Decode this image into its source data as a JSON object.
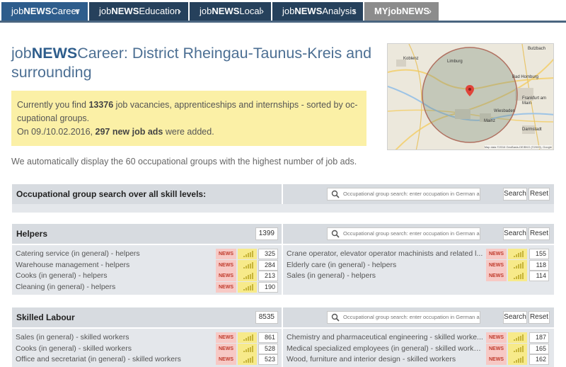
{
  "tabs": [
    {
      "pre": "job",
      "bold": "NEWS",
      "post": "Career",
      "active": true
    },
    {
      "pre": "job",
      "bold": "NEWS",
      "post": "Education",
      "active": false
    },
    {
      "pre": "job",
      "bold": "NEWS",
      "post": "Local",
      "active": false
    },
    {
      "pre": "job",
      "bold": "NEWS",
      "post": "Analysis",
      "active": false
    },
    {
      "pre": "MY",
      "bold": "jobNEWS",
      "post": "",
      "active": false
    }
  ],
  "tab_chevrons": {
    "active": "∨",
    "normal": "›"
  },
  "title": {
    "pre": "job",
    "bold": "NEWS",
    "post": "Career: District Rheingau-Taunus-Kreis and surrounding"
  },
  "info": {
    "line1_pre": "Currently you find ",
    "line1_count": "13376",
    "line1_post": " job vacancies, apprenticeships and internships - sorted by oc-",
    "line2": "cupational groups.",
    "line3_pre": "On 09./10.02.2016, ",
    "line3_bold": "297 new job ads",
    "line3_post": " were added."
  },
  "map": {
    "labels": [
      "Koblenz",
      "Frankfurt am Main",
      "Wiesbaden",
      "Mainz",
      "Darmstadt",
      "Bad Homburg",
      "Limburg",
      "Butzbach"
    ],
    "copyright": "Map data ©2016 GeoBasis-DE/BKG (©2009), Google"
  },
  "autonote": "We automatically display the 60 occupational groups with the highest number of job ads.",
  "search": {
    "placeholder": "Occupational group search: enter occupation in German a",
    "search_label": "Search",
    "reset_label": "Reset"
  },
  "overall": {
    "label": "Occupational group search over all skill levels:"
  },
  "news_badge": "NEWS",
  "groups": [
    {
      "label": "Helpers",
      "count": "1399",
      "left": [
        {
          "name": "Catering service (in general) - helpers",
          "value": "325"
        },
        {
          "name": "Warehouse management - helpers",
          "value": "284"
        },
        {
          "name": "Cooks (in general) - helpers",
          "value": "213"
        },
        {
          "name": "Cleaning (in general) - helpers",
          "value": "190"
        }
      ],
      "right": [
        {
          "name": "Crane operator, elevator operator machinists and related l...",
          "value": "155"
        },
        {
          "name": "Elderly care (in general) - helpers",
          "value": "118"
        },
        {
          "name": "Sales (in general) - helpers",
          "value": "114"
        }
      ]
    },
    {
      "label": "Skilled Labour",
      "count": "8535",
      "left": [
        {
          "name": "Sales (in general) - skilled workers",
          "value": "861"
        },
        {
          "name": "Cooks (in general) - skilled workers",
          "value": "528"
        },
        {
          "name": "Office and secretariat (in general) - skilled workers",
          "value": "523"
        }
      ],
      "right": [
        {
          "name": "Chemistry and pharmaceutical engineering - skilled worke...",
          "value": "187"
        },
        {
          "name": "Medical specialized employees (in general) - skilled worker...",
          "value": "165"
        },
        {
          "name": "Wood, furniture and interior design - skilled workers",
          "value": "162"
        }
      ]
    }
  ]
}
